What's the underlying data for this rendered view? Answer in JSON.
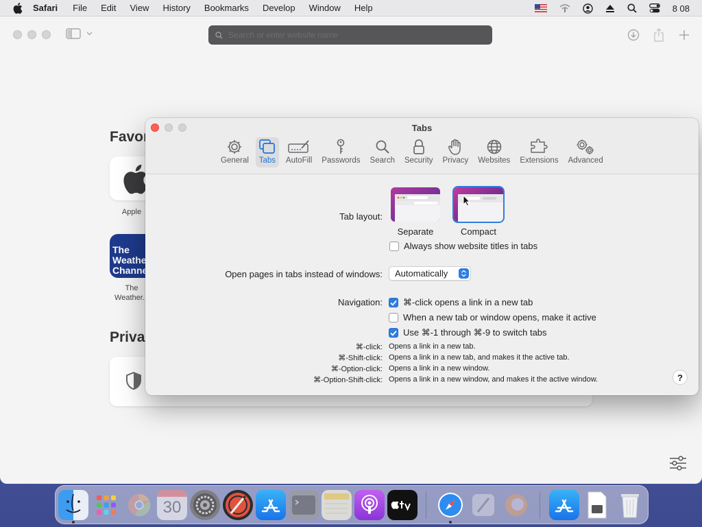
{
  "menubar": {
    "app_name": "Safari",
    "items": [
      "File",
      "Edit",
      "View",
      "History",
      "Bookmarks",
      "Develop",
      "Window",
      "Help"
    ],
    "clock": "8 08"
  },
  "safari": {
    "address_placeholder": "Search or enter website name",
    "favorites_heading": "Favor",
    "privacy_heading": "Priva",
    "favorites": [
      {
        "label": "Apple"
      },
      {
        "label": "The Weather...",
        "tile_text": "The Weathe Channe"
      }
    ]
  },
  "prefs": {
    "title": "Tabs",
    "tabs": [
      {
        "label": "General",
        "icon": "gear-icon"
      },
      {
        "label": "Tabs",
        "icon": "tabs-icon",
        "active": true
      },
      {
        "label": "AutoFill",
        "icon": "autofill-icon"
      },
      {
        "label": "Passwords",
        "icon": "key-icon"
      },
      {
        "label": "Search",
        "icon": "search-icon"
      },
      {
        "label": "Security",
        "icon": "lock-icon"
      },
      {
        "label": "Privacy",
        "icon": "hand-icon"
      },
      {
        "label": "Websites",
        "icon": "globe-icon"
      },
      {
        "label": "Extensions",
        "icon": "puzzle-icon"
      },
      {
        "label": "Advanced",
        "icon": "gears-icon"
      }
    ],
    "tab_layout": {
      "label": "Tab layout:",
      "separate": "Separate",
      "compact": "Compact",
      "selected": "Compact"
    },
    "always_show_titles": {
      "label": "Always show website titles in tabs",
      "checked": false
    },
    "open_pages": {
      "label": "Open pages in tabs instead of windows:",
      "value": "Automatically"
    },
    "navigation": {
      "label": "Navigation:",
      "options": [
        {
          "label": "⌘-click opens a link in a new tab",
          "checked": true
        },
        {
          "label": "When a new tab or window opens, make it active",
          "checked": false
        },
        {
          "label": "Use ⌘-1 through ⌘-9 to switch tabs",
          "checked": true
        }
      ]
    },
    "shortcuts": [
      {
        "key": "⌘-click:",
        "desc": "Opens a link in a new tab."
      },
      {
        "key": "⌘-Shift-click:",
        "desc": "Opens a link in a new tab, and makes it the active tab."
      },
      {
        "key": "⌘-Option-click:",
        "desc": "Opens a link in a new window."
      },
      {
        "key": "⌘-Option-Shift-click:",
        "desc": "Opens a link in a new window, and makes it the active window."
      }
    ],
    "help": "?"
  },
  "dock": {
    "calendar_day": "30",
    "apps": [
      "Finder",
      "Launchpad",
      "Chrome",
      "Calendar",
      "System Preferences",
      "Instruments",
      "App Store",
      "Terminal",
      "Notes",
      "Podcasts",
      "Apple TV",
      "Safari",
      "Script Editor",
      "Firefox",
      "App Store Beta",
      "Preview",
      "Trash"
    ]
  },
  "colors": {
    "accent": "#2f7de1",
    "close_red": "#ff5f57"
  }
}
